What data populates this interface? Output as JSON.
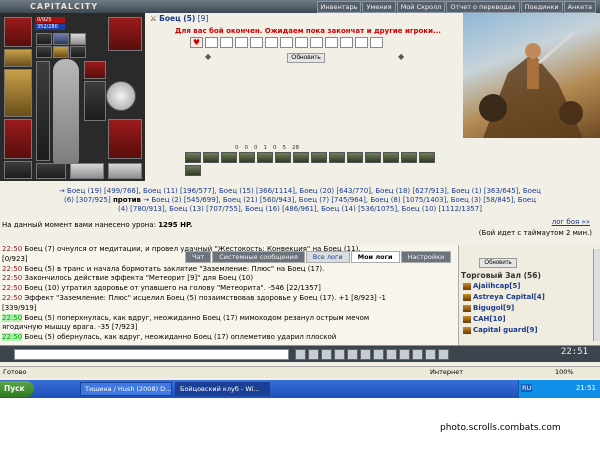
{
  "topbar": {
    "logo": "CAPITALCITY",
    "nav": [
      "Инвентарь",
      "Умения",
      "Мой Скролл",
      "Отчет о переводах",
      "Поединки",
      "Анкета"
    ]
  },
  "character": {
    "hp": "0/925",
    "mana": "352/280"
  },
  "battle": {
    "opponent_name": "Боец (5)",
    "opponent_hp": "[9]",
    "wait_message": "Для вас бой окончен. Ожидаем пока закончат и другие игроки...",
    "refresh_label": "Обновить",
    "stats": [
      "0",
      "0",
      "0",
      "1",
      "0",
      "5",
      "28"
    ],
    "team1": "→ Боец (19) [499/766], Боец (11) [196/577], Боец (15) [366/1114], Боец (20) [643/770], Боец (18) [627/913], Боец (1) [363/645], Боец",
    "team1b": "(6) [307/925]",
    "vs": "против",
    "team2": "→ Боец (2) [545/699], Боец (21) [560/943], Боец (7) [745/964], Боец (8) [1075/1403], Боец (3) [58/845], Боец",
    "team2b": "(4) [780/913], Боец (13) [707/755], Боец (16) [486/961], Боец (14) [536/1075], Боец (10) [1112/1357]",
    "damage_label": "На данный момент вами нанесено урона:",
    "damage_value": "1295 HP.",
    "log_link": "лог боя »»",
    "timeout": "(Бой идет с таймаутом 2 мин.)"
  },
  "chat": {
    "tabs": [
      "Чат",
      "Системные сообщения",
      "Все логи",
      "Мои логи",
      "Настройки"
    ],
    "lines": [
      {
        "t": "22:50",
        "text": "Боец (7) очнулся от медитации, и провел удачный \"Жестокость: Конвекция\" на Боец (11)."
      },
      {
        "t": "",
        "text": "[0/923]"
      },
      {
        "t": "22:50",
        "text": "Боец (5) в транс и начала бормотать заклятие \"Заземление: Плюс\" на Боец (17)."
      },
      {
        "t": "22:50",
        "text": "Закончилось действие эффекта \"Метеорит [9]\" для Боец (10)"
      },
      {
        "t": "22:50",
        "text": "Боец (10) утратил здоровье от упавшего на голову \"Метеорита\". -546 [22/1357]"
      },
      {
        "t": "22:50",
        "text": "Эффект \"Заземление: Плюс\" исцелил Боец (5) позаимствовав здоровье у Боец (17). +1 [8/923] -1"
      },
      {
        "t": "",
        "text": "[339/919]"
      },
      {
        "t": "22:50",
        "text": "Боец (5) поперхнулась, как вдруг, неожиданно Боец (17) мимоходом резанул острым мечом"
      },
      {
        "t": "",
        "text": "ягодичную мышцу врага. -35 [7/923]"
      },
      {
        "t": "22:50",
        "text": "Боец (5) обернулась, как вдруг, неожиданно Боец (17) оплеметиво ударил плоской"
      }
    ]
  },
  "users": {
    "refresh_label": "Обновить",
    "title": "Торговый Зал",
    "count": "(56)",
    "list": [
      "Ajaiihcap[5]",
      "Astreya Capital[4]",
      "Bigugol[9]",
      "CAH[10]",
      "Capital guard[9]"
    ]
  },
  "gamebar": {
    "clock": "22:51"
  },
  "statusbar": {
    "left": "Готово",
    "internet": "Интернет",
    "zoom": "100%"
  },
  "taskbar": {
    "start": "Пуск",
    "tasks": [
      "Тишина / Hush (2008) D...",
      "Бойцовский клуб - Wi..."
    ],
    "lang": "RU",
    "time": "21:51"
  },
  "caption": "photo.scrolls.combats.com"
}
